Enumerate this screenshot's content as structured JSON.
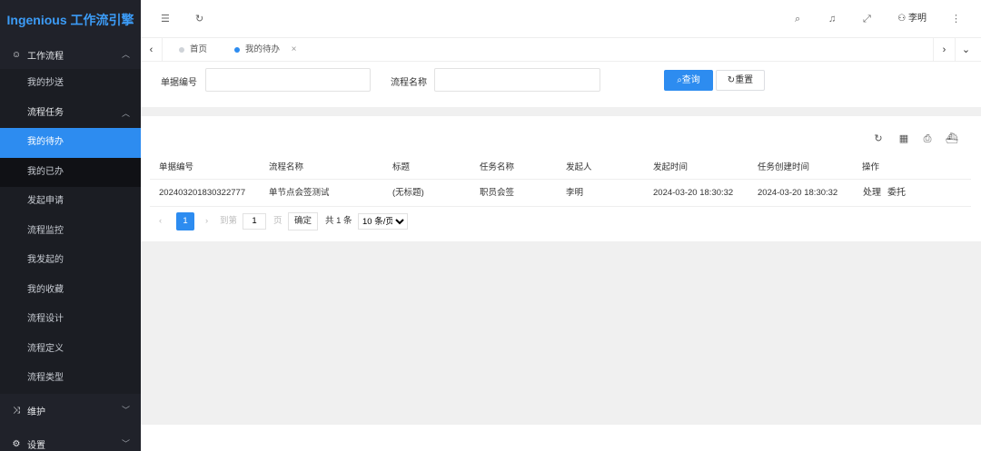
{
  "app": {
    "title": "Ingenious 工作流引擎"
  },
  "sidebar": {
    "group_workflow": "工作流程",
    "items": [
      {
        "label": "我的抄送"
      },
      {
        "label": "流程任务"
      },
      {
        "label": "我的待办"
      },
      {
        "label": "我的已办"
      },
      {
        "label": "发起申请"
      },
      {
        "label": "流程监控"
      },
      {
        "label": "我发起的"
      },
      {
        "label": "我的收藏"
      },
      {
        "label": "流程设计"
      },
      {
        "label": "流程定义"
      },
      {
        "label": "流程类型"
      }
    ],
    "group_maintain": "维护",
    "group_settings": "设置"
  },
  "header": {
    "user_name": "李明"
  },
  "tabs": [
    {
      "label": "首页"
    },
    {
      "label": "我的待办"
    }
  ],
  "search": {
    "field1_label": "单据编号",
    "field1_value": "",
    "field2_label": "流程名称",
    "field2_value": "",
    "query_label": "查询",
    "reset_label": "重置"
  },
  "table": {
    "columns": [
      "单据编号",
      "流程名称",
      "标题",
      "任务名称",
      "发起人",
      "发起时间",
      "任务创建时间",
      "操作"
    ],
    "rows": [
      {
        "doc_no": "202403201830322777",
        "process": "单节点会签测试",
        "title": "(无标题)",
        "task": "职员会签",
        "initiator": "李明",
        "start_time": "2024-03-20 18:30:32",
        "created_time": "2024-03-20 18:30:32",
        "action_handle": "处理",
        "action_delegate": "委托"
      }
    ]
  },
  "pager": {
    "current": "1",
    "goto_label": "到第",
    "goto_value": "1",
    "page_unit": "页",
    "confirm_label": "确定",
    "total_label": "共 1 条",
    "page_size": "10 条/页"
  },
  "colors": {
    "accent": "#2d8cf0",
    "sidebar_bg": "#20222a",
    "logo": "#3c9cf7"
  }
}
